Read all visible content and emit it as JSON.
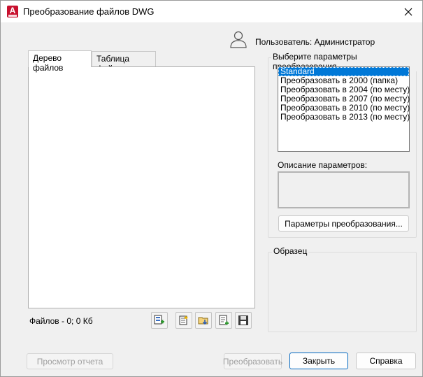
{
  "window": {
    "title": "Преобразование файлов DWG",
    "app_icon_letter": "A"
  },
  "user": {
    "label": "Пользователь: Администратор"
  },
  "tabs": [
    {
      "label": "Дерево файлов",
      "active": true
    },
    {
      "label": "Таблица файлов",
      "active": false
    }
  ],
  "files": {
    "status": "Файлов - 0; 0 Кб"
  },
  "toolbar": {
    "icons": [
      "new-list-icon",
      "open-list-icon",
      "append-list-icon",
      "add-file-icon",
      "save-list-icon"
    ]
  },
  "params_group": {
    "legend": "Выберите параметры преобразования",
    "items": [
      {
        "label": "Standard",
        "selected": true
      },
      {
        "label": "Преобразовать в 2000 (папка)",
        "selected": false
      },
      {
        "label": "Преобразовать в 2004 (по месту)",
        "selected": false
      },
      {
        "label": "Преобразовать в 2007 (по месту)",
        "selected": false
      },
      {
        "label": "Преобразовать в 2010 (по месту)",
        "selected": false
      },
      {
        "label": "Преобразовать в 2013 (по месту)",
        "selected": false
      }
    ],
    "description_label": "Описание параметров:",
    "description_text": "",
    "params_button": "Параметры преобразования..."
  },
  "sample_group": {
    "legend": "Образец"
  },
  "footer": {
    "report_button": "Просмотр отчета",
    "convert_button": "Преобразовать",
    "close_button": "Закрыть",
    "help_button": "Справка"
  },
  "colors": {
    "selection": "#0078d7",
    "app_icon": "#c8102e",
    "default_button_border": "#0067c0"
  }
}
